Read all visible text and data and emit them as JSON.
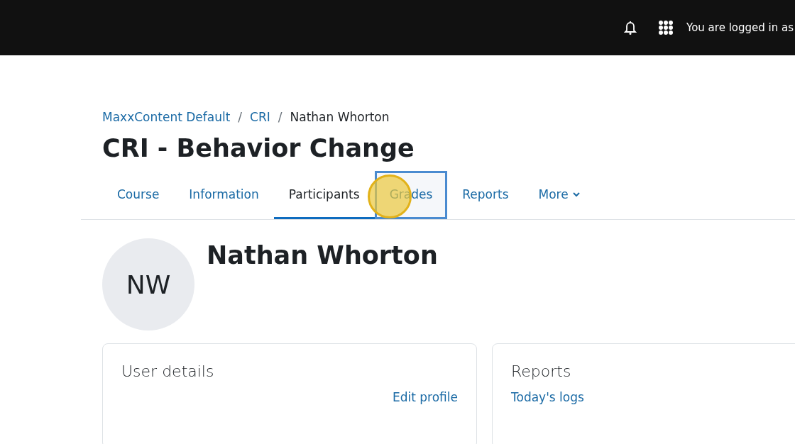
{
  "navbar": {
    "login_text": "You are logged in as"
  },
  "breadcrumb": [
    {
      "label": "MaxxContent Default",
      "link": true
    },
    {
      "label": "CRI",
      "link": true
    },
    {
      "label": "Nathan Whorton",
      "link": false
    }
  ],
  "separator": "/",
  "course_title": "CRI - Behavior Change",
  "tabs": [
    {
      "label": "Course",
      "selected": false,
      "highlighted": false
    },
    {
      "label": "Information",
      "selected": false,
      "highlighted": false
    },
    {
      "label": "Participants",
      "selected": true,
      "highlighted": false
    },
    {
      "label": "Grades",
      "selected": false,
      "highlighted": true
    },
    {
      "label": "Reports",
      "selected": false,
      "highlighted": false
    },
    {
      "label": "More",
      "selected": false,
      "highlighted": false,
      "dropdown": true
    }
  ],
  "user": {
    "initials": "NW",
    "name": "Nathan Whorton"
  },
  "cards": [
    {
      "title": "User details",
      "kind": "details",
      "links": [
        {
          "label": "Edit profile"
        }
      ]
    },
    {
      "title": "Reports",
      "kind": "reports",
      "links": [
        {
          "label": "Today's logs"
        }
      ]
    }
  ]
}
